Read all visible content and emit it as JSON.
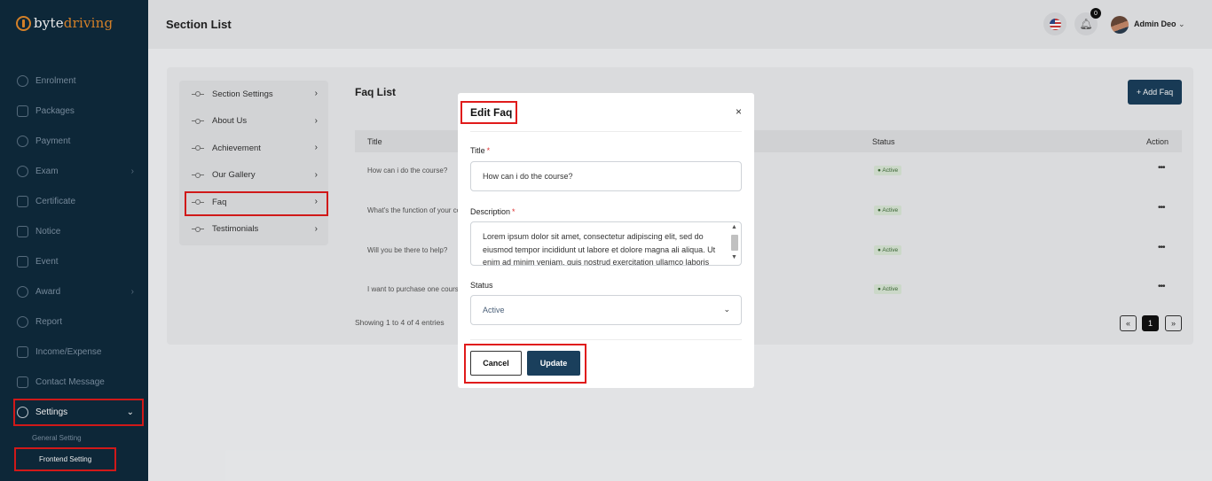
{
  "brand": {
    "part1": "byte",
    "part2": "driving"
  },
  "sidebar": {
    "items": [
      {
        "label": "Enrolment",
        "icon": "enrolment-icon"
      },
      {
        "label": "Packages",
        "icon": "packages-icon"
      },
      {
        "label": "Payment",
        "icon": "payment-icon"
      },
      {
        "label": "Exam",
        "icon": "exam-icon"
      },
      {
        "label": "Certificate",
        "icon": "certificate-icon"
      },
      {
        "label": "Notice",
        "icon": "notice-icon"
      },
      {
        "label": "Event",
        "icon": "event-icon"
      },
      {
        "label": "Award",
        "icon": "award-icon"
      },
      {
        "label": "Report",
        "icon": "report-icon"
      },
      {
        "label": "Income/Expense",
        "icon": "income-expense-icon"
      },
      {
        "label": "Contact Message",
        "icon": "contact-message-icon"
      },
      {
        "label": "Settings",
        "icon": "gear-icon"
      }
    ],
    "sub_items": [
      {
        "label": "General Setting"
      },
      {
        "label": "Frontend Setting"
      }
    ]
  },
  "header": {
    "title": "Section List",
    "notification_count": "0",
    "user_name": "Admin Deo"
  },
  "section_menu": {
    "items": [
      {
        "label": "Section Settings"
      },
      {
        "label": "About Us"
      },
      {
        "label": "Achievement"
      },
      {
        "label": "Our Gallery"
      },
      {
        "label": "Faq"
      },
      {
        "label": "Testimonials"
      }
    ]
  },
  "faq_list": {
    "title": "Faq List",
    "add_label": "+ Add Faq",
    "columns": {
      "title": "Title",
      "status": "Status",
      "action": "Action"
    },
    "rows": [
      {
        "title": "How can i do the course?",
        "status": "Active"
      },
      {
        "title": "What's the function of your course?",
        "status": "Active"
      },
      {
        "title": "Will you be there to help?",
        "status": "Active"
      },
      {
        "title": "I want to purchase one course",
        "status": "Active"
      }
    ],
    "showing": "Showing 1 to 4 of 4 entries",
    "pagination": {
      "prev": "«",
      "current": "1",
      "next": "»"
    }
  },
  "modal": {
    "title": "Edit Faq",
    "close": "×",
    "title_label": "Title",
    "title_value": "How can i do the course?",
    "description_label": "Description",
    "description_value": "Lorem ipsum dolor sit amet, consectetur adipiscing elit, sed do eiusmod tempor incididunt ut labore et dolore magna ali aliqua. Ut enim ad minim veniam, quis nostrud exercitation ullamco laboris",
    "required_mark": "*",
    "status_label": "Status",
    "status_value": "Active",
    "cancel_label": "Cancel",
    "update_label": "Update"
  },
  "colors": {
    "sidebar_bg": "#0f2a3d",
    "brand_accent": "#e38a2c",
    "primary_button": "#1a3f5c",
    "highlight": "#e01b1b",
    "active_badge_bg": "#dbe9d8"
  }
}
